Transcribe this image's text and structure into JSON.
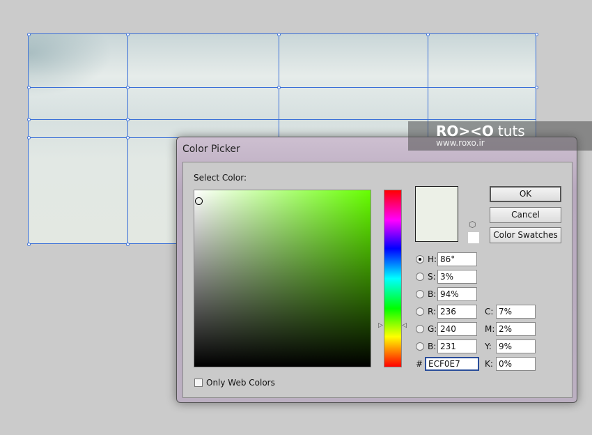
{
  "watermark": {
    "brand": "RO><O",
    "suffix": "tuts",
    "url": "www.roxo.ir"
  },
  "dialog": {
    "title": "Color Picker",
    "select_label": "Select Color:",
    "ok": "OK",
    "cancel": "Cancel",
    "swatches": "Color Swatches",
    "web_only": "Only Web Colors",
    "fields": {
      "H": "86°",
      "S": "3%",
      "Bv": "94%",
      "R": "236",
      "G": "240",
      "B": "231",
      "C": "7%",
      "M": "2%",
      "Y": "9%",
      "K": "0%",
      "hex": "ECF0E7"
    },
    "labels": {
      "H": "H:",
      "S": "S:",
      "Bv": "B:",
      "R": "R:",
      "G": "G:",
      "B": "B:",
      "C": "C:",
      "M": "M:",
      "Y": "Y:",
      "K": "K:",
      "hash": "#"
    },
    "selected_hue_radio": "H",
    "new_color": "#ecf0e7"
  }
}
